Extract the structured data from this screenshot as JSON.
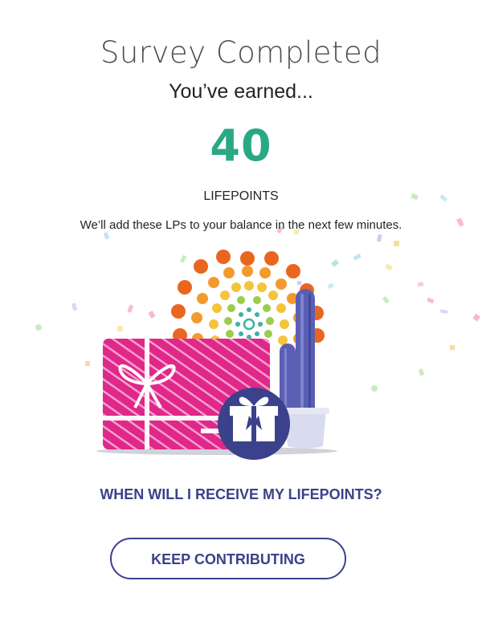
{
  "survey": {
    "title": "Survey Completed",
    "earned_text": "You’ve earned...",
    "points_value": "40",
    "points_unit": "LIFEPOINTS",
    "balance_note": "We’ll add these LPs to your balance in the next few minutes."
  },
  "links": {
    "faq_label": "WHEN WILL I RECEIVE MY LIFEPOINTS?"
  },
  "actions": {
    "keep_contributing_label": "KEEP CONTRIBUTING"
  },
  "colors": {
    "accent_green": "#2aa884",
    "brand_navy": "#3b418a",
    "gift_card_pink": "#e0278a",
    "burst_orange": "#e9661e"
  },
  "illustration": {
    "icons": [
      "gift-card-icon",
      "gift-box-icon",
      "cactus-icon",
      "dot-burst-icon",
      "confetti"
    ]
  }
}
